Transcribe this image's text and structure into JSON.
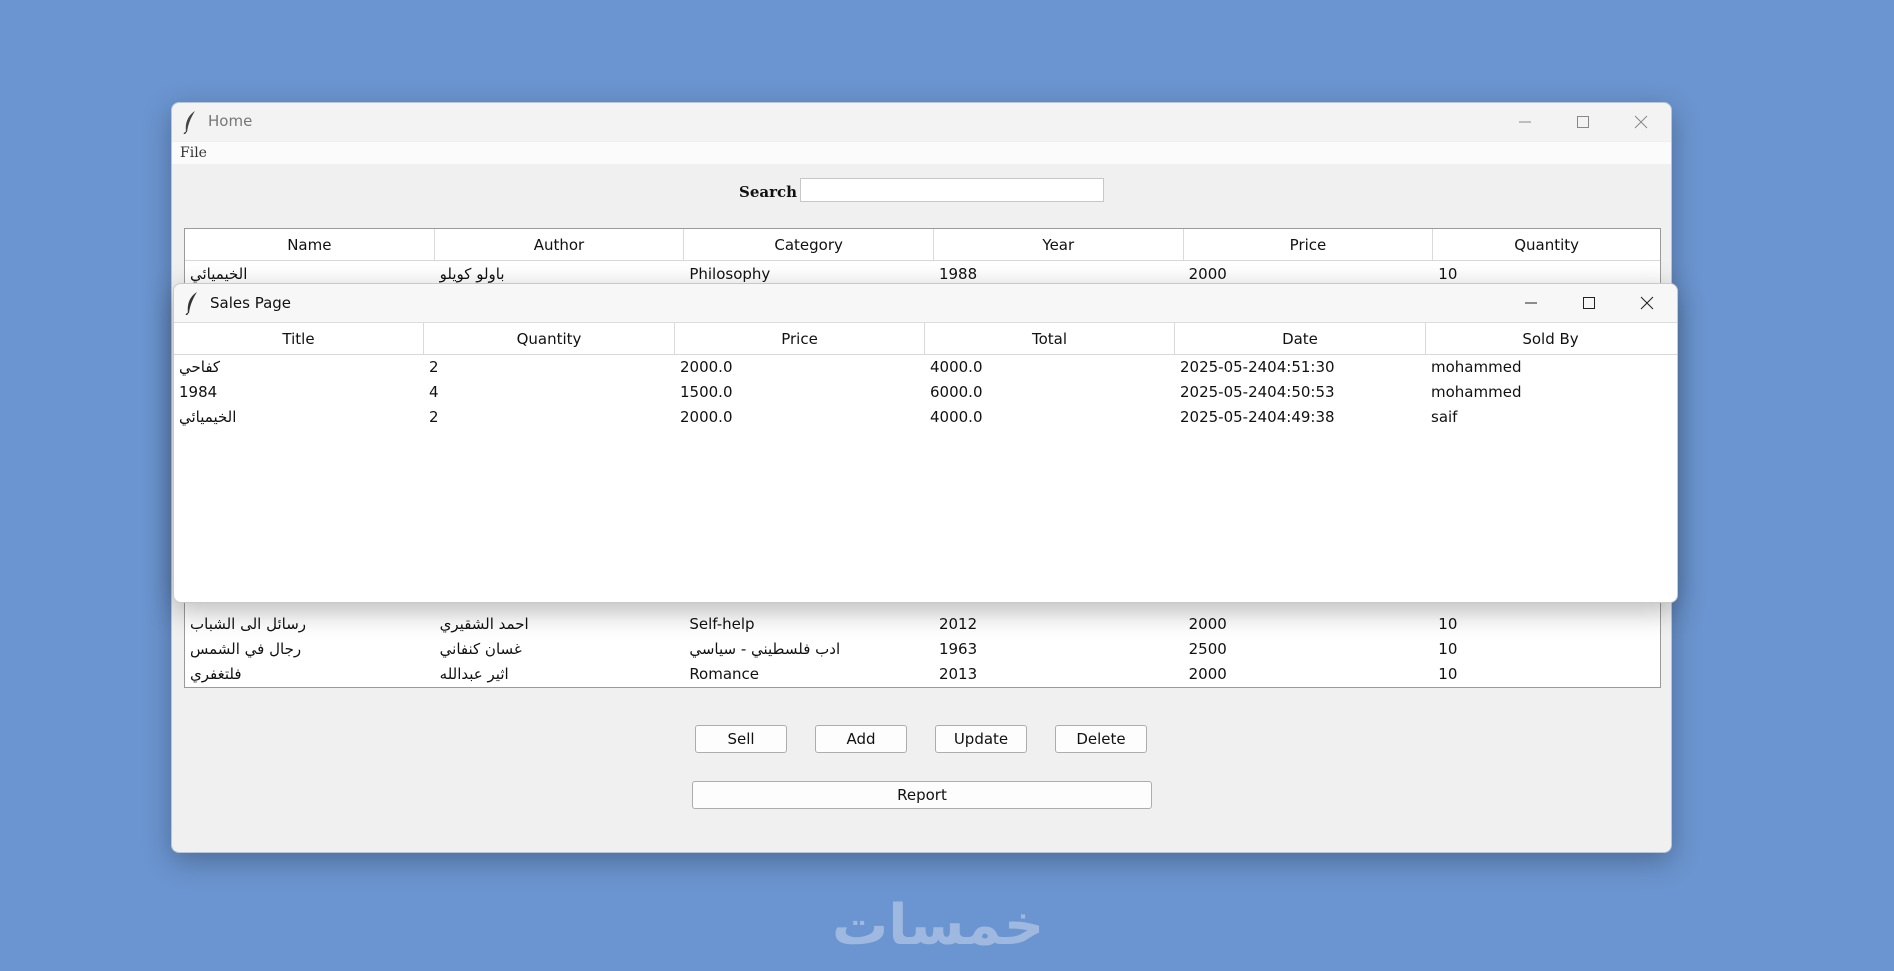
{
  "home": {
    "title": "Home",
    "menu": {
      "file": "File"
    },
    "search": {
      "label": "Search",
      "value": ""
    },
    "columns": [
      "Name",
      "Author",
      "Category",
      "Year",
      "Price",
      "Quantity"
    ],
    "rows_top": [
      [
        "الخيميائي",
        "باولو كويلو",
        "Philosophy",
        "1988",
        "2000",
        "10"
      ]
    ],
    "rows_bottom": [
      [
        "رسائل الى الشباب",
        "احمد الشقيري",
        "Self-help",
        "2012",
        "2000",
        "10"
      ],
      [
        "رجال في الشمس",
        "غسان كنفاني",
        "ادب فلسطيني - سياسي",
        "1963",
        "2500",
        "10"
      ],
      [
        "فلتغفري",
        "اثير عبدالله",
        "Romance",
        "2013",
        "2000",
        "10"
      ]
    ],
    "buttons": {
      "sell": "Sell",
      "add": "Add",
      "update": "Update",
      "delete": "Delete",
      "report": "Report"
    }
  },
  "sales": {
    "title": "Sales Page",
    "columns": [
      "Title",
      "Quantity",
      "Price",
      "Total",
      "Date",
      "Sold By"
    ],
    "rows": [
      [
        "كفاحي",
        "2",
        "2000.0",
        "4000.0",
        "2025-05-2404:51:30",
        "mohammed"
      ],
      [
        "1984",
        "4",
        "1500.0",
        "6000.0",
        "2025-05-2404:50:53",
        "mohammed"
      ],
      [
        "الخيميائي",
        "2",
        "2000.0",
        "4000.0",
        "2025-05-2404:49:38",
        "saif"
      ]
    ]
  },
  "watermark": "خمسات",
  "colors": {
    "desktop": "#6b95d0",
    "window": "#f0f0f0",
    "table": "#ffffff"
  },
  "icons": [
    "feather-icon",
    "minimize-icon",
    "maximize-icon",
    "close-icon"
  ]
}
